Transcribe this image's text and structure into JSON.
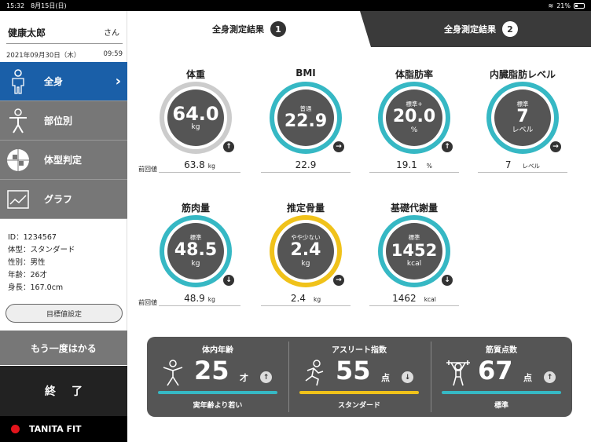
{
  "status": {
    "time": "15:32",
    "date": "8月15日(日)",
    "battery": "21%"
  },
  "user": {
    "name": "健康太郎",
    "suffix": "さん",
    "date": "2021年09月30日（木）",
    "clock": "09:59"
  },
  "menu": [
    {
      "label": "全身",
      "icon": "person-icon"
    },
    {
      "label": "部位別",
      "icon": "body-parts-icon"
    },
    {
      "label": "体型判定",
      "icon": "grid-icon"
    },
    {
      "label": "グラフ",
      "icon": "graph-icon"
    }
  ],
  "profile": {
    "id": "ID：1234567",
    "type": "体型：スタンダード",
    "sex": "性別：男性",
    "age": "年齢：26才",
    "height": "身長：167.0cm"
  },
  "buttons": {
    "goal": "目標値設定",
    "remeasure": "もう一度はかる",
    "finish": "終了"
  },
  "brand": "TANITA FIT",
  "tabs": [
    {
      "label": "全身測定結果",
      "num": "1"
    },
    {
      "label": "全身測定結果",
      "num": "2"
    }
  ],
  "prev_label": "前回値",
  "metrics": {
    "weight": {
      "title": "体重",
      "judge": "",
      "value": "64.0",
      "unit": "kg",
      "arrow": "↑",
      "prev": "63.8",
      "prev_unit": "kg"
    },
    "bmi": {
      "title": "BMI",
      "judge": "普通",
      "value": "22.9",
      "unit": "",
      "arrow": "→",
      "prev": "22.9",
      "prev_unit": ""
    },
    "bodyfat": {
      "title": "体脂肪率",
      "judge": "標準+",
      "value": "20.0",
      "unit": "%",
      "arrow": "↑",
      "prev": "19.1",
      "prev_unit": "%"
    },
    "visceral": {
      "title": "内臓脂肪レベル",
      "judge": "標準",
      "value": "7",
      "unit": "レベル",
      "arrow": "→",
      "prev": "7",
      "prev_unit": "レベル"
    },
    "muscle": {
      "title": "筋肉量",
      "judge": "標準",
      "value": "48.5",
      "unit": "kg",
      "arrow": "↓",
      "prev": "48.9",
      "prev_unit": "kg"
    },
    "bone": {
      "title": "推定骨量",
      "judge": "やや少ない",
      "value": "2.4",
      "unit": "kg",
      "arrow": "→",
      "prev": "2.4",
      "prev_unit": "kg"
    },
    "bmr": {
      "title": "基礎代謝量",
      "judge": "標準",
      "value": "1452",
      "unit": "kcal",
      "arrow": "↓",
      "prev": "1462",
      "prev_unit": "kcal"
    }
  },
  "panel": {
    "age": {
      "title": "体内年齢",
      "value": "25",
      "unit": "才",
      "arrow": "↑",
      "status": "実年齢より若い"
    },
    "athlete": {
      "title": "アスリート指数",
      "value": "55",
      "unit": "点",
      "arrow": "↓",
      "status": "スタンダード"
    },
    "muscle_score": {
      "title": "筋質点数",
      "value": "67",
      "unit": "点",
      "arrow": "↑",
      "status": "標準"
    }
  },
  "colors": {
    "primary": "#1a5fa8",
    "teal": "#36b8c4",
    "yellow": "#f0c21a",
    "red": "#e3141c"
  }
}
